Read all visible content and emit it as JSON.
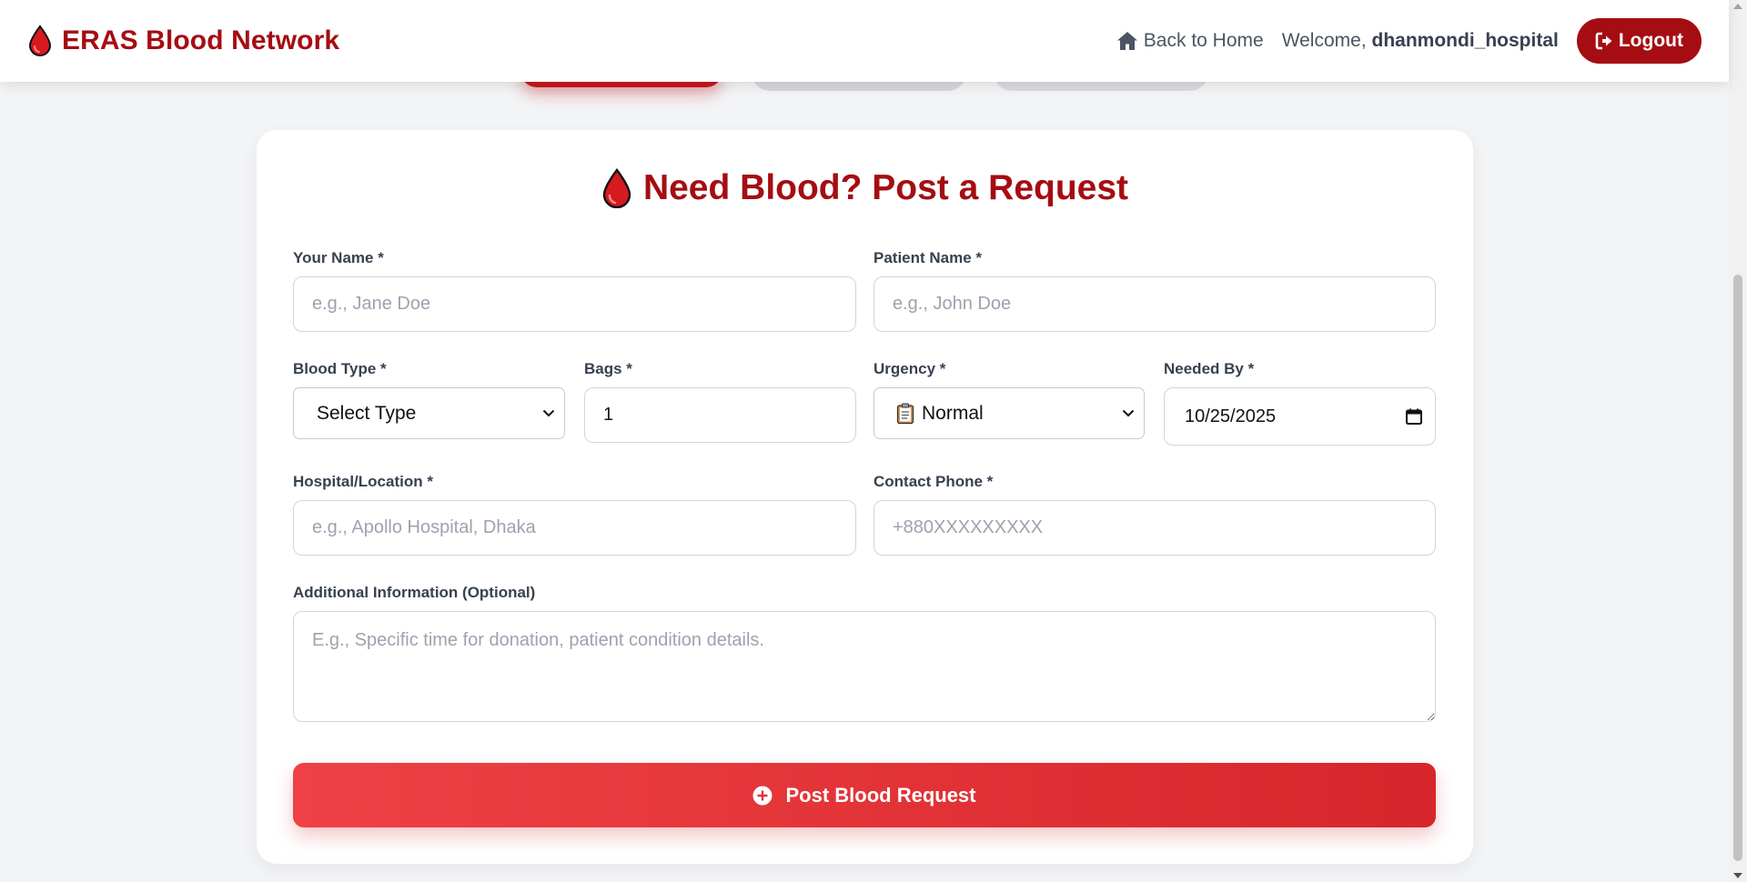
{
  "header": {
    "brand_title": "ERAS Blood Network",
    "back_home_label": "Back to Home",
    "welcome_prefix": "Welcome,",
    "username": "dhanmondi_hospital",
    "logout_label": "Logout"
  },
  "form": {
    "title": "Need Blood? Post a Request",
    "your_name": {
      "label": "Your Name *",
      "placeholder": "e.g., Jane Doe"
    },
    "patient_name": {
      "label": "Patient Name *",
      "placeholder": "e.g., John Doe"
    },
    "blood_type": {
      "label": "Blood Type *",
      "selected": "Select Type"
    },
    "bags": {
      "label": "Bags *",
      "value": "1"
    },
    "urgency": {
      "label": "Urgency *",
      "selected": "Normal",
      "icon": "clipboard-icon"
    },
    "needed_by": {
      "label": "Needed By *",
      "value": "10/25/2025"
    },
    "hospital": {
      "label": "Hospital/Location *",
      "placeholder": "e.g., Apollo Hospital, Dhaka"
    },
    "contact_phone": {
      "label": "Contact Phone *",
      "placeholder": "+880XXXXXXXXX"
    },
    "additional_info": {
      "label": "Additional Information (Optional)",
      "placeholder": "E.g., Specific time for donation, patient condition details."
    },
    "submit_label": "Post Blood Request"
  },
  "colors": {
    "brand": "#a50d12",
    "accent_red": "#ef4145",
    "accent_red_dark": "#d7262b",
    "background": "#f3f4f6"
  }
}
